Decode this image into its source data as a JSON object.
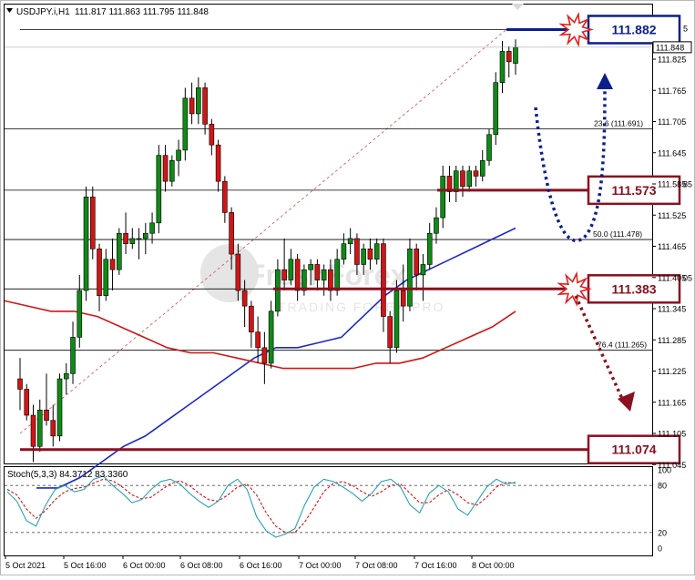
{
  "header": {
    "symbol_label": "USDJPY.i,H1",
    "ohlc_label": "111.817 111.863 111.795 111.848"
  },
  "stoch": {
    "label": "Stoch(5,3,3) 84.3712 83.3360",
    "levels": [
      "100",
      "80",
      "20",
      "0"
    ]
  },
  "watermark": {
    "brand": "FreshForex",
    "tagline": "TRADING FOREX PRO"
  },
  "colors": {
    "candle_up": "#0f8a16",
    "candle_down": "#d11515",
    "ma_fast": "#1d28c8",
    "ma_slow": "#d11515",
    "fib_line": "#d94b4b",
    "level_high": "#0b1f8a",
    "level_dark": "#8b1020",
    "stoch_main": "#2aa1b5",
    "stoch_signal": "#d11515",
    "axis_text": "#000000"
  },
  "chart_data": {
    "type": "candlestick",
    "symbol": "USDJPY.i",
    "timeframe": "H1",
    "ohlc_last": {
      "open": 111.817,
      "high": 111.863,
      "low": 111.795,
      "close": 111.848
    },
    "price_ticks": [
      "111.825",
      "111.765",
      "111.705",
      "111.645",
      "111.585",
      "111.525",
      "111.465",
      "111.405",
      "111.345",
      "111.285",
      "111.225",
      "111.165",
      "111.105",
      "111.045"
    ],
    "price_ticks_partial": {
      "top": "5",
      "mid1": "85",
      "mid2": "05"
    },
    "current_price": "111.848",
    "time_labels": [
      "5 Oct 2021",
      "5 Oct 16:00",
      "6 Oct 00:00",
      "6 Oct 08:00",
      "6 Oct 16:00",
      "7 Oct 00:00",
      "7 Oct 08:00",
      "7 Oct 16:00",
      "8 Oct 00:00"
    ],
    "key_levels": [
      {
        "label": "111.882",
        "price": 111.882,
        "style": "high"
      },
      {
        "label": "111.573",
        "price": 111.573,
        "style": "dark"
      },
      {
        "label": "111.383",
        "price": 111.383,
        "style": "dark"
      },
      {
        "label": "111.074",
        "price": 111.074,
        "style": "dark"
      }
    ],
    "fib_levels": [
      {
        "label": "23.6 (111.691)",
        "price": 111.691
      },
      {
        "label": "50.0 (111.478)",
        "price": 111.478
      },
      {
        "label": "76.4 (111.265)",
        "price": 111.265
      }
    ],
    "candles": [
      [
        111.21,
        111.25,
        111.15,
        111.19
      ],
      [
        111.19,
        111.2,
        111.13,
        111.14
      ],
      [
        111.14,
        111.16,
        111.05,
        111.08
      ],
      [
        111.08,
        111.17,
        111.07,
        111.15
      ],
      [
        111.15,
        111.22,
        111.12,
        111.13
      ],
      [
        111.13,
        111.16,
        111.08,
        111.1
      ],
      [
        111.1,
        111.22,
        111.09,
        111.21
      ],
      [
        111.21,
        111.24,
        111.18,
        111.22
      ],
      [
        111.22,
        111.32,
        111.2,
        111.29
      ],
      [
        111.29,
        111.41,
        111.27,
        111.38
      ],
      [
        111.38,
        111.58,
        111.36,
        111.56
      ],
      [
        111.56,
        111.58,
        111.44,
        111.46
      ],
      [
        111.46,
        111.47,
        111.34,
        111.37
      ],
      [
        111.37,
        111.46,
        111.36,
        111.44
      ],
      [
        111.44,
        111.48,
        111.38,
        111.42
      ],
      [
        111.42,
        111.5,
        111.41,
        111.49
      ],
      [
        111.49,
        111.53,
        111.45,
        111.47
      ],
      [
        111.47,
        111.5,
        111.46,
        111.48
      ],
      [
        111.48,
        111.5,
        111.44,
        111.48
      ],
      [
        111.48,
        111.51,
        111.45,
        111.49
      ],
      [
        111.49,
        111.53,
        111.47,
        111.51
      ],
      [
        111.51,
        111.66,
        111.49,
        111.64
      ],
      [
        111.64,
        111.66,
        111.57,
        111.59
      ],
      [
        111.59,
        111.64,
        111.58,
        111.63
      ],
      [
        111.63,
        111.67,
        111.6,
        111.65
      ],
      [
        111.65,
        111.77,
        111.63,
        111.75
      ],
      [
        111.75,
        111.78,
        111.7,
        111.72
      ],
      [
        111.72,
        111.79,
        111.7,
        111.77
      ],
      [
        111.77,
        111.78,
        111.68,
        111.7
      ],
      [
        111.7,
        111.71,
        111.64,
        111.66
      ],
      [
        111.66,
        111.67,
        111.57,
        111.59
      ],
      [
        111.59,
        111.6,
        111.51,
        111.53
      ],
      [
        111.53,
        111.54,
        111.42,
        111.45
      ],
      [
        111.45,
        111.47,
        111.36,
        111.38
      ],
      [
        111.38,
        111.4,
        111.31,
        111.35
      ],
      [
        111.35,
        111.36,
        111.27,
        111.3
      ],
      [
        111.3,
        111.33,
        111.24,
        111.27
      ],
      [
        111.27,
        111.3,
        111.2,
        111.24
      ],
      [
        111.24,
        111.36,
        111.23,
        111.34
      ],
      [
        111.34,
        111.44,
        111.33,
        111.42
      ],
      [
        111.42,
        111.48,
        111.38,
        111.4
      ],
      [
        111.4,
        111.46,
        111.39,
        111.44
      ],
      [
        111.44,
        111.45,
        111.36,
        111.38
      ],
      [
        111.38,
        111.43,
        111.37,
        111.42
      ],
      [
        111.42,
        111.44,
        111.39,
        111.43
      ],
      [
        111.43,
        111.44,
        111.38,
        111.4
      ],
      [
        111.4,
        111.43,
        111.37,
        111.42
      ],
      [
        111.42,
        111.44,
        111.36,
        111.38
      ],
      [
        111.38,
        111.46,
        111.37,
        111.44
      ],
      [
        111.44,
        111.49,
        111.43,
        111.47
      ],
      [
        111.47,
        111.5,
        111.45,
        111.48
      ],
      [
        111.48,
        111.49,
        111.41,
        111.43
      ],
      [
        111.43,
        111.47,
        111.41,
        111.46
      ],
      [
        111.46,
        111.48,
        111.42,
        111.44
      ],
      [
        111.44,
        111.48,
        111.43,
        111.47
      ],
      [
        111.47,
        111.48,
        111.3,
        111.33
      ],
      [
        111.33,
        111.34,
        111.24,
        111.27
      ],
      [
        111.27,
        111.4,
        111.26,
        111.38
      ],
      [
        111.38,
        111.43,
        111.32,
        111.35
      ],
      [
        111.35,
        111.48,
        111.34,
        111.46
      ],
      [
        111.46,
        111.47,
        111.38,
        111.41
      ],
      [
        111.41,
        111.45,
        111.36,
        111.43
      ],
      [
        111.43,
        111.51,
        111.42,
        111.49
      ],
      [
        111.49,
        111.54,
        111.47,
        111.52
      ],
      [
        111.52,
        111.62,
        111.5,
        111.6
      ],
      [
        111.6,
        111.62,
        111.55,
        111.57
      ],
      [
        111.57,
        111.62,
        111.55,
        111.61
      ],
      [
        111.61,
        111.62,
        111.56,
        111.58
      ],
      [
        111.58,
        111.62,
        111.57,
        111.61
      ],
      [
        111.61,
        111.62,
        111.58,
        111.6
      ],
      [
        111.6,
        111.65,
        111.59,
        111.63
      ],
      [
        111.63,
        111.69,
        111.62,
        111.68
      ],
      [
        111.68,
        111.8,
        111.66,
        111.78
      ],
      [
        111.78,
        111.86,
        111.76,
        111.84
      ],
      [
        111.84,
        111.85,
        111.79,
        111.82
      ],
      [
        111.817,
        111.863,
        111.795,
        111.848
      ]
    ],
    "ma_fast": [
      111.0,
      111.0,
      111.02,
      111.05,
      111.08,
      111.1,
      111.13,
      111.16,
      111.19,
      111.22,
      111.25,
      111.27,
      111.27,
      111.28,
      111.29,
      111.33,
      111.37,
      111.4,
      111.42,
      111.44,
      111.46,
      111.48,
      111.5
    ],
    "ma_slow": [
      111.36,
      111.35,
      111.34,
      111.34,
      111.33,
      111.31,
      111.29,
      111.27,
      111.26,
      111.26,
      111.25,
      111.24,
      111.23,
      111.23,
      111.23,
      111.23,
      111.24,
      111.24,
      111.25,
      111.27,
      111.29,
      111.31,
      111.34
    ],
    "stoch_k": [
      72,
      60,
      35,
      28,
      55,
      75,
      80,
      72,
      75,
      88,
      92,
      80,
      70,
      58,
      62,
      75,
      85,
      88,
      82,
      70,
      60,
      52,
      60,
      80,
      88,
      75,
      40,
      22,
      14,
      18,
      25,
      55,
      78,
      88,
      85,
      78,
      70,
      60,
      70,
      85,
      88,
      78,
      55,
      45,
      70,
      80,
      72,
      50,
      42,
      60,
      78,
      88,
      82,
      84
    ],
    "stoch_d": [
      75,
      68,
      50,
      38,
      48,
      62,
      72,
      76,
      78,
      83,
      88,
      86,
      78,
      68,
      63,
      65,
      74,
      82,
      86,
      80,
      70,
      62,
      60,
      68,
      78,
      82,
      68,
      45,
      28,
      20,
      20,
      33,
      52,
      72,
      83,
      85,
      80,
      72,
      66,
      72,
      80,
      82,
      70,
      58,
      58,
      68,
      75,
      68,
      58,
      55,
      65,
      78,
      84,
      83
    ]
  }
}
